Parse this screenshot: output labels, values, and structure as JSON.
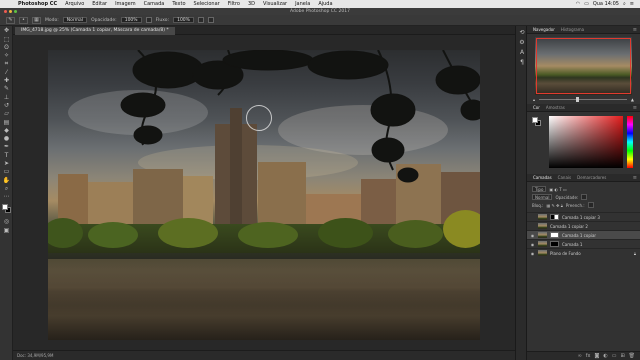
{
  "menubar": {
    "app_name": "Photoshop CC",
    "items": [
      "Arquivo",
      "Editar",
      "Imagem",
      "Camada",
      "Texto",
      "Selecionar",
      "Filtro",
      "3D",
      "Visualizar",
      "Janela",
      "Ajuda"
    ],
    "clock": "Qua 14:05"
  },
  "window": {
    "title": "Adobe Photoshop CC 2017"
  },
  "options_bar": {
    "mode_label": "Modo:",
    "mode_value": "Normal",
    "opacity_label": "Opacidade:",
    "opacity_value": "100%",
    "flow_label": "Fluxo:",
    "flow_value": "100%"
  },
  "document": {
    "tab_label": "IMG_4718.jpg @ 25% (Camada 1 copiar, Máscara de camada/8) *",
    "status_text": "Doc: 34,9M/95,9M"
  },
  "panels": {
    "navigator_tabs": [
      "Navegador",
      "Histograma"
    ],
    "color_tabs": [
      "Cor",
      "Amostras"
    ],
    "layers_tabs": [
      "Camadas",
      "Canais",
      "Demarcadores"
    ],
    "layers_filter": "Tipo",
    "blend_mode": "Normal",
    "opacity_label": "Opacidade:",
    "fill_label": "Preench.:",
    "lock_label": "Bloq.:",
    "layers": [
      {
        "name": "Camada 1 copiar 3",
        "mask": "half",
        "visible": false,
        "selected": false
      },
      {
        "name": "Camada 1 copiar 2",
        "mask": "none",
        "visible": false,
        "selected": false
      },
      {
        "name": "Camada 1 copiar",
        "mask": "white",
        "visible": true,
        "selected": true
      },
      {
        "name": "Camada 1",
        "mask": "black",
        "visible": true,
        "selected": false
      },
      {
        "name": "Plano de Fundo",
        "mask": "none",
        "visible": true,
        "selected": false
      }
    ]
  },
  "colors": {
    "foreground": "#ffffff",
    "background": "#000000",
    "accent": "#e03a2f"
  }
}
